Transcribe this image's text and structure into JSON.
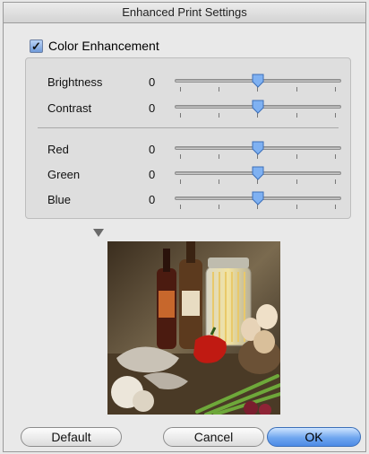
{
  "window": {
    "title": "Enhanced Print Settings"
  },
  "color_enhancement": {
    "label": "Color Enhancement",
    "checked": true,
    "check_glyph": "✓"
  },
  "sliders": {
    "brightness": {
      "label": "Brightness",
      "value": "0"
    },
    "contrast": {
      "label": "Contrast",
      "value": "0"
    },
    "red": {
      "label": "Red",
      "value": "0"
    },
    "green": {
      "label": "Green",
      "value": "0"
    },
    "blue": {
      "label": "Blue",
      "value": "0"
    }
  },
  "buttons": {
    "default": "Default",
    "cancel": "Cancel",
    "ok": "OK"
  },
  "colors": {
    "accent": "#5b97ea",
    "thumb": "#7fb1f2"
  }
}
